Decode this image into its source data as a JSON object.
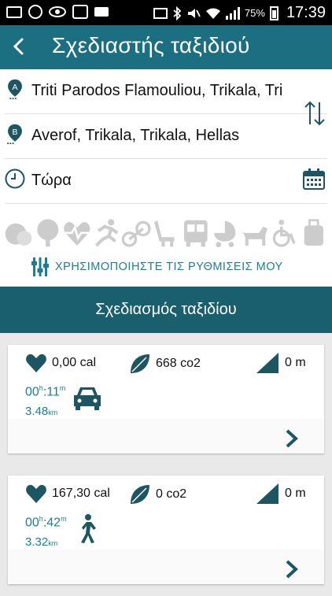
{
  "status_bar": {
    "battery": "75%",
    "time": "17:39"
  },
  "header": {
    "title": "Σχεδιαστής ταξιδιού"
  },
  "form": {
    "origin": "Triti Parodos Flamouliou, Trikala, Tri",
    "destination": "Averof, Trikala, Trikala, Hellas",
    "when": "Τώρα",
    "origin_marker": "A",
    "destination_marker": "B",
    "settings_label": "ΧΡΗΣΙΜΟΠΟΙΗΣΤΕ ΤΙΣ ΡΥΘΜΙΣΕΙΣ ΜΟΥ",
    "profile_icons": [
      "money-icon",
      "tree-icon",
      "heart-rate-icon",
      "runner-icon",
      "bike-icon",
      "seat-icon",
      "bus-icon",
      "stroller-icon",
      "dog-icon",
      "wheelchair-icon",
      "luggage-icon"
    ]
  },
  "section": {
    "title": "Σχεδιασμός ταξιδίου"
  },
  "results": [
    {
      "calories": "0,00 cal",
      "co2": "668 co2",
      "elevation": "0 m",
      "hours": "00",
      "minutes": ":11",
      "h_unit": "h",
      "m_unit": "m",
      "distance": "3.48",
      "distance_unit": "km",
      "mode_icon": "car-icon"
    },
    {
      "calories": "167,30 cal",
      "co2": "0 co2",
      "elevation": "0 m",
      "hours": "00",
      "minutes": ":42",
      "h_unit": "h",
      "m_unit": "m",
      "distance": "3.32",
      "distance_unit": "km",
      "mode_icon": "walking-icon"
    }
  ],
  "colors": {
    "header": "#1b6f80",
    "section": "#1a5f6e",
    "accent": "#1b7f93",
    "icon_dark": "#1d5563",
    "icon_light": "#cccccc"
  }
}
